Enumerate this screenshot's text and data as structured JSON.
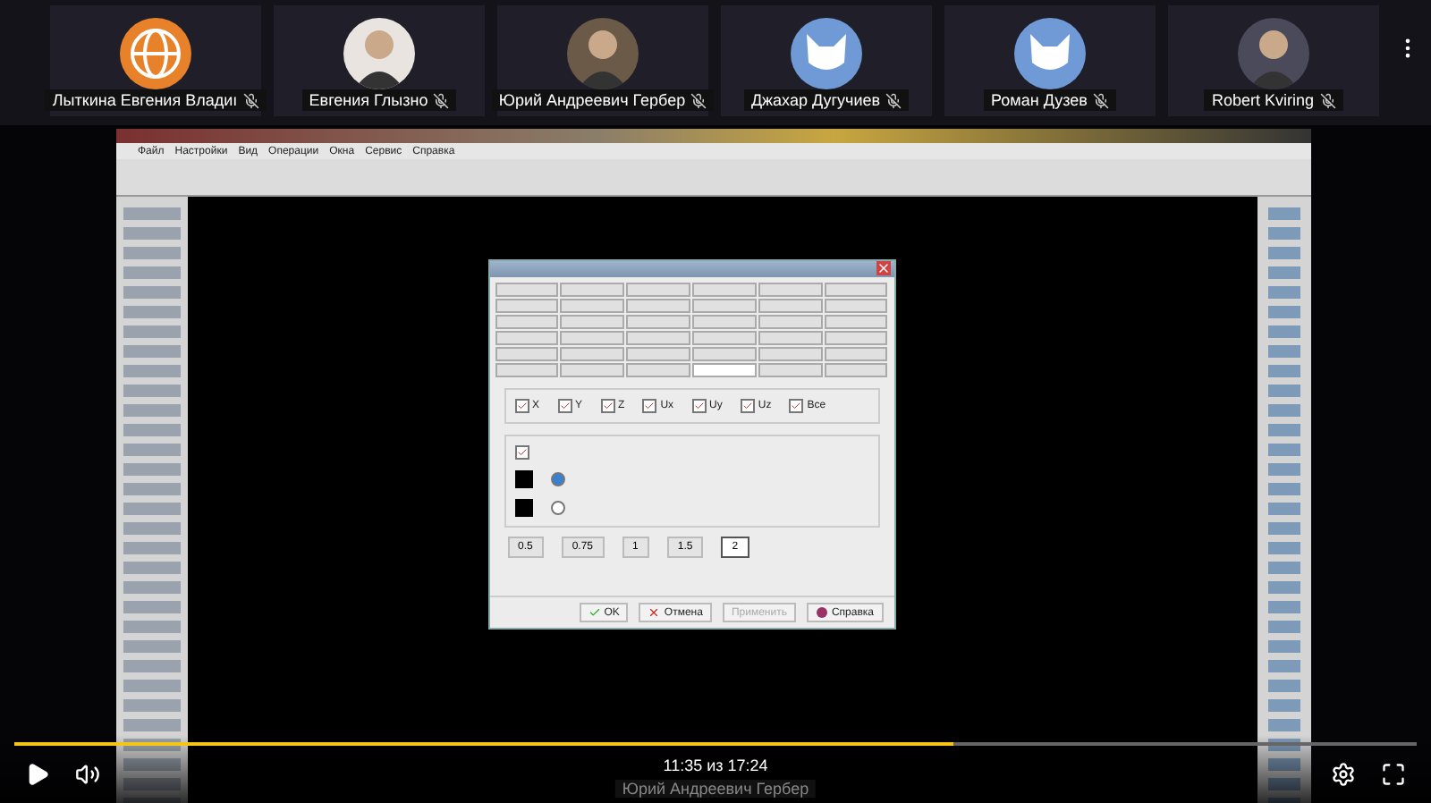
{
  "participants": [
    {
      "name": "Лыткина Евгения Владиı",
      "color": "#e8822a",
      "kind": "logo"
    },
    {
      "name": "Евгения Глызно",
      "color": "#e9e4df",
      "kind": "photo"
    },
    {
      "name": "Юрий Андреевич Гербер",
      "color": "#6b5a48",
      "kind": "photo"
    },
    {
      "name": "Джахар Дугучиев",
      "color": "#6f9ad6",
      "kind": "animal"
    },
    {
      "name": "Роман Дузев",
      "color": "#6f9ad6",
      "kind": "animal"
    },
    {
      "name": "Robert Kviring",
      "color": "#4a4a5a",
      "kind": "photo"
    }
  ],
  "app": {
    "menu": [
      "Файл",
      "Настройки",
      "Вид",
      "Операции",
      "Окна",
      "Сервис",
      "Справка"
    ]
  },
  "dialog": {
    "axes": [
      {
        "label": "X",
        "checked": true
      },
      {
        "label": "Y",
        "checked": true
      },
      {
        "label": "Z",
        "checked": true
      },
      {
        "label": "Ux",
        "checked": true
      },
      {
        "label": "Uy",
        "checked": true
      },
      {
        "label": "Uz",
        "checked": true
      }
    ],
    "all": {
      "label": "Все",
      "checked": true
    },
    "display": {
      "checked": true
    },
    "radios": [
      {
        "selected": true
      },
      {
        "selected": false
      }
    ],
    "sizes": [
      {
        "label": "0.5",
        "selected": false
      },
      {
        "label": "0.75",
        "selected": false
      },
      {
        "label": "1",
        "selected": false
      },
      {
        "label": "1.5",
        "selected": false
      },
      {
        "label": "2",
        "selected": true
      }
    ],
    "buttons": [
      {
        "label": "OK",
        "kind": "ok",
        "disabled": false
      },
      {
        "label": "Отмена",
        "kind": "cancel",
        "disabled": false
      },
      {
        "label": "Применить",
        "kind": "apply",
        "disabled": true
      },
      {
        "label": "Справка",
        "kind": "help",
        "disabled": false
      }
    ]
  },
  "player": {
    "time": "11:35 из 17:24",
    "level": 0.67,
    "presenter": "Юрий Андреевич Гербер"
  }
}
